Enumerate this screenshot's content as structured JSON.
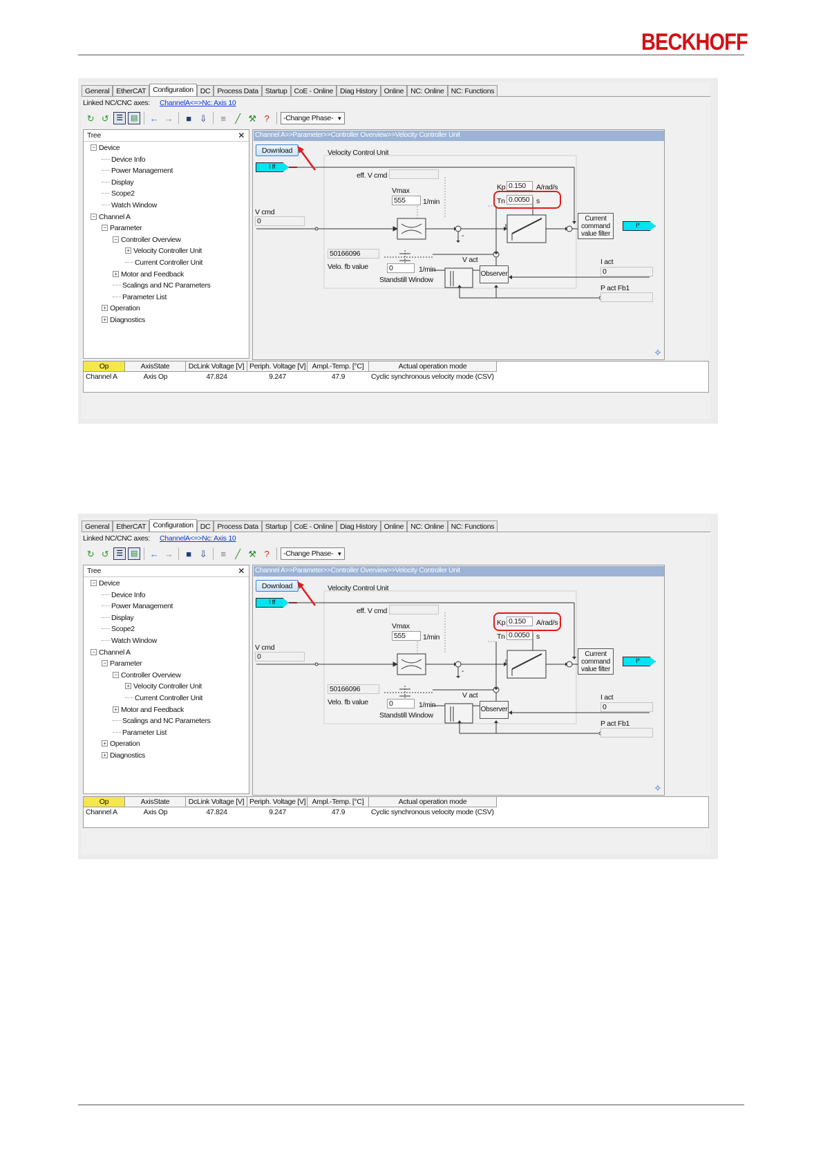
{
  "brand": {
    "logo": "BECKHOFF",
    "color": "#d40f14"
  },
  "screenshots": [
    {
      "id": "tn",
      "highlight": "tn"
    },
    {
      "id": "kp",
      "highlight": "kp"
    }
  ],
  "ui": {
    "tabs": [
      "General",
      "EtherCAT",
      "Configuration",
      "DC",
      "Process Data",
      "Startup",
      "CoE - Online",
      "Diag History",
      "Online",
      "NC: Online",
      "NC: Functions"
    ],
    "active_tab": "Configuration",
    "linked_label": "Linked NC/CNC axes:",
    "linked_value": "ChannelA<=>Nc: Axis 10",
    "phase_select": "-Change Phase-",
    "tree": {
      "title": "Tree",
      "close": "✕",
      "nodes": [
        "Device",
        "Device Info",
        "Power Management",
        "Display",
        "Scope2",
        "Watch Window",
        "Channel A",
        "Parameter",
        "Controller Overview",
        "Velocity Controller Unit",
        "Current Controller Unit",
        "Motor and Feedback",
        "Scalings and NC Parameters",
        "Parameter List",
        "Operation",
        "Diagnostics"
      ]
    },
    "breadcrumb": "Channel A>>Parameter>>Controller Overview>>Velocity Controller Unit",
    "download": "Download",
    "iff": "I ff",
    "diagram": {
      "title": "Velocity Control Unit",
      "eff_vcmd": "eff. V cmd",
      "vmax": "Vmax",
      "vmax_value": "555",
      "unit_rpm": "1/min",
      "kp": "Kp",
      "kp_value": "0.150",
      "kp_unit": "A/rad/s",
      "tn": "Tn",
      "tn_value": "0.0050",
      "tn_unit": "s",
      "vcmd": "V cmd",
      "vcmd_value": "0",
      "current_filter": [
        "Current",
        "command",
        "value filter"
      ],
      "i_out": "I*",
      "vact": "V act",
      "big_value": "50166096",
      "velo_fb": "Velo. fb value",
      "velo_fb_value": "0",
      "standstill": "Standstill Window",
      "observer": "Observer",
      "iact": "I act",
      "iact_value": "0",
      "pact": "P act Fb1",
      "minus": "-"
    },
    "status": {
      "headers": [
        "Op",
        "AxisState",
        "DcLink Voltage [V]",
        "Periph. Voltage [V]",
        "Ampl.-Temp. [°C]",
        "Actual operation mode"
      ],
      "row": [
        "Channel A",
        "Axis Op",
        "47.824",
        "9.247",
        "47.9",
        "Cyclic synchronous velocity mode (CSV)"
      ]
    }
  }
}
